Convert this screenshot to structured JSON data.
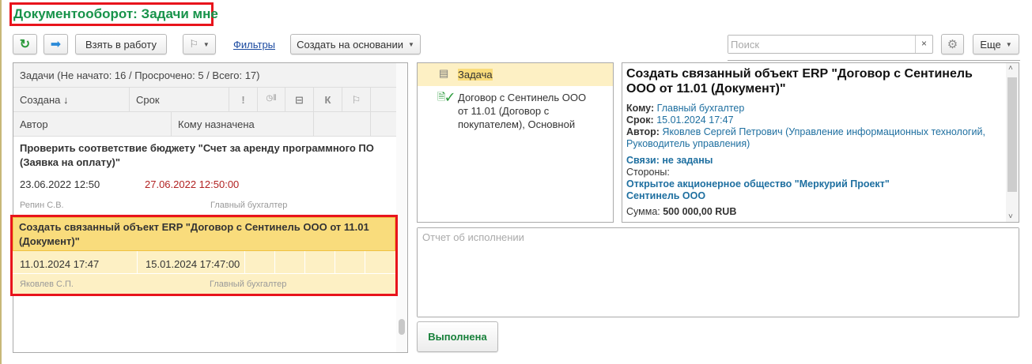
{
  "title": "Документооборот: Задачи мне",
  "toolbar": {
    "take": "Взять в работу",
    "filters": "Фильтры",
    "create_based": "Создать на основании",
    "search_placeholder": "Поиск",
    "clear": "×",
    "more": "Еще"
  },
  "list": {
    "summary": "Задачи (Не начато: 16 / Просрочено: 5 / Всего: 17)",
    "columns": {
      "created": "Создана ↓",
      "due": "Срок",
      "importance": "!",
      "k": "К",
      "author": "Автор",
      "assignee": "Кому назначена"
    },
    "items": [
      {
        "title": "Проверить соответствие бюджету \"Счет за аренду программного ПО (Заявка на оплату)\"",
        "created": "23.06.2022 12:50",
        "due": "27.06.2022 12:50:00",
        "author": "Репин С.В.",
        "assignee": "Главный бухгалтер"
      },
      {
        "title": "Создать связанный объект ERP \"Договор с Сентинель ООО от 11.01 (Документ)\"",
        "created": "11.01.2024 17:47",
        "due": "15.01.2024 17:47:00",
        "author": "Яковлев С.П.",
        "assignee": "Главный бухгалтер"
      }
    ]
  },
  "objects": [
    {
      "label": "Задача"
    },
    {
      "label": "Договор с Сентинель ООО от 11.01 (Договор с покупателем), Основной"
    }
  ],
  "detail": {
    "title": "Создать связанный объект ERP \"Договор с Сентинель ООО от 11.01 (Документ)\"",
    "to_label": "Кому:",
    "to": "Главный бухгалтер",
    "due_label": "Срок:",
    "due": "15.01.2024 17:47",
    "author_label": "Автор:",
    "author": "Яковлев Сергей Петрович (Управление информационных технологий, Руководитель управления)",
    "links": "Связи: не заданы",
    "parties_label": "Стороны:",
    "party1": "Открытое акционерное общество \"Меркурий Проект\"",
    "party2": "Сентинель ООО",
    "sum_label": "Сумма:",
    "sum": "500 000,00 RUB"
  },
  "report_placeholder": "Отчет об исполнении",
  "done": "Выполнена",
  "colors": {
    "title": "#17934a",
    "highlight": "#e8141c",
    "selected": "#f9dc7c",
    "overdue": "#b22222",
    "link": "#1e6fa0"
  }
}
